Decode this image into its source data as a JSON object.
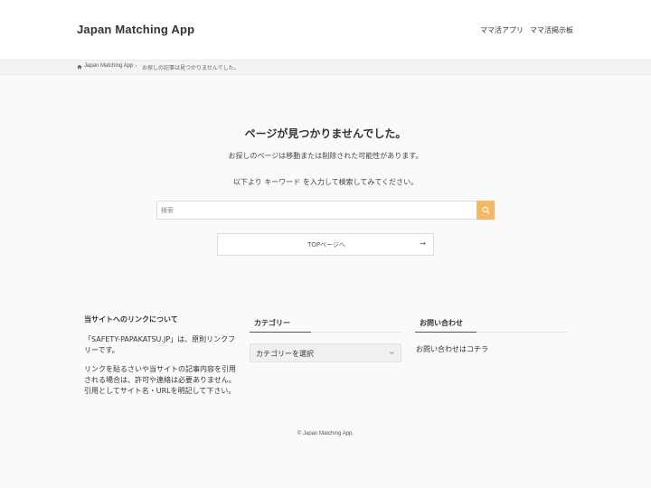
{
  "header": {
    "site_title": "Japan Matching App",
    "nav": [
      "ママ活アプリ",
      "ママ活掲示板"
    ]
  },
  "breadcrumb": {
    "home": "Japan Matching App",
    "separator": "›",
    "current": "お探しの記事は見つかりませんでした。"
  },
  "not_found": {
    "title": "ページが見つかりませんでした。",
    "message1": "お探しのページは移動または削除された可能性があります。",
    "message2": "以下より キーワード を入力して検索してみてください。"
  },
  "search": {
    "placeholder": "検索",
    "button_icon": "search-icon",
    "button_color": "#f5b867"
  },
  "top_button": {
    "label": "TOPページへ",
    "arrow": "→"
  },
  "footer_widgets": {
    "link_policy": {
      "title": "当サイトへのリンクについて",
      "paragraph1": "「SAFETY-PAPAKATSU.JP」は、原則リンクフリーです。",
      "paragraph2": "リンクを貼るさいや当サイトの記事内容を引用される場合は、許可や連絡は必要ありません。引用としてサイト名・URLを明記して下さい。"
    },
    "category": {
      "title": "カテゴリー",
      "select_label": "カテゴリーを選択"
    },
    "contact": {
      "title": "お問い合わせ",
      "text": "お問い合わせはコチラ"
    }
  },
  "footer": {
    "copyright": "© Japan Matching App."
  }
}
